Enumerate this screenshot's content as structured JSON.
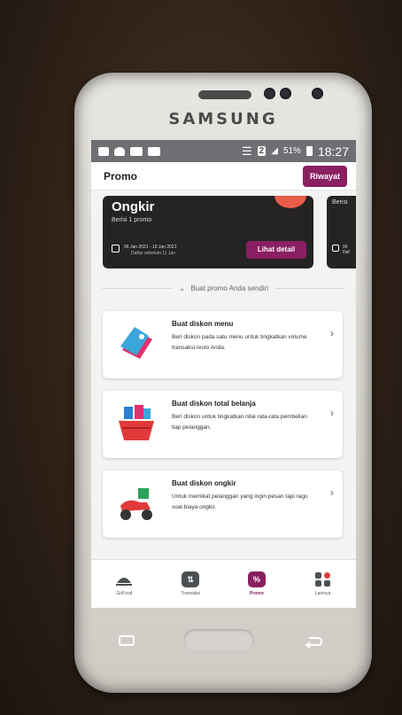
{
  "device": {
    "brand": "SAMSUNG"
  },
  "status_bar": {
    "battery": "51%",
    "time": "18:27",
    "sim": "2"
  },
  "app_bar": {
    "title": "Promo",
    "history_button": "Riwayat"
  },
  "promo_card": {
    "title": "Ongkir",
    "subtitle": "Berisi 1 promo",
    "date_range": "06 Jan 2021 - 19 Jan 2021",
    "note": "Daftar sebelum 11 Jan",
    "detail_button": "Lihat detail"
  },
  "promo_card_2": {
    "subtitle": "Berisi",
    "text_1": "06",
    "text_2": "Daf"
  },
  "section_toggle": {
    "label": "Buat promo Anda sendiri"
  },
  "options": [
    {
      "title": "Buat diskon menu",
      "desc": "Beri diskon pada satu menu untuk tingkatkan volume transaksi resto Anda."
    },
    {
      "title": "Buat diskon total belanja",
      "desc": "Beri diskon untuk tingkatkan nilai rata-rata pembelian tiap pelanggan."
    },
    {
      "title": "Buat diskon ongkir",
      "desc": "Untuk memikat pelanggan yang ingin pesan tapi ragu soal biaya ongkir."
    }
  ],
  "bottom_nav": [
    {
      "label": "GoFood"
    },
    {
      "label": "Transaksi"
    },
    {
      "label": "Promo",
      "active": true
    },
    {
      "label": "Lainnya"
    }
  ],
  "colors": {
    "accent": "#8a1f62",
    "card_dark": "#262323",
    "status_bar": "#6e6e73"
  }
}
